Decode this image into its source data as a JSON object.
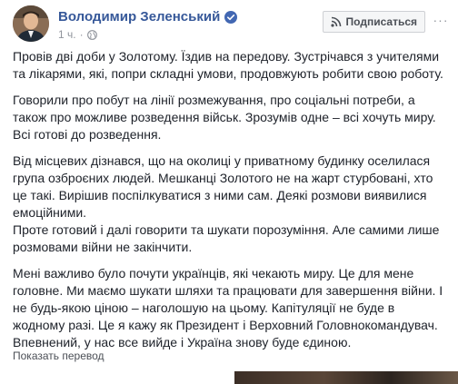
{
  "post": {
    "author": "Володимир Зеленський",
    "time": "1 ч.",
    "separator": "·",
    "subscribe_label": "Подписаться",
    "more_label": "···",
    "paragraphs": [
      "Провів дві доби у Золотому. Їздив на передову. Зустрічався з учителями та лікарями, які, попри складні умови, продовжують робити свою роботу.",
      "Говорили про побут на лінії розмежування, про соціальні потреби, а також про можливе розведення військ. Зрозумів одне – всі хочуть миру. Всі готові до розведення.",
      "Від місцевих дізнався, що на околиці у приватному будинку оселилася група озброєних людей. Мешканці Золотого не на жарт стурбовані, хто це такі. Вирішив поспілкуватися з ними сам. Деякі розмови виявилися емоційними.",
      "Проте готовий і далі говорити та шукати порозуміння. Але самими лише розмовами війни не закінчити.",
      "Мені важливо було почути українців, які чекають миру. Це для мене головне. Ми маємо шукати шляхи та працювати для завершення війни. І не будь-якою ціною – наголошую на цьому. Капітуляції не буде в жодному разі. Це я кажу як Президент і Верховний Головнокомандувач. Впевнений, у нас все вийде і Україна знову буде єдиною."
    ],
    "translate_label": "Показать перевод"
  },
  "colors": {
    "author": "#365899",
    "text": "#1d2129",
    "meta": "#90949c",
    "verified": "#4267b2"
  }
}
